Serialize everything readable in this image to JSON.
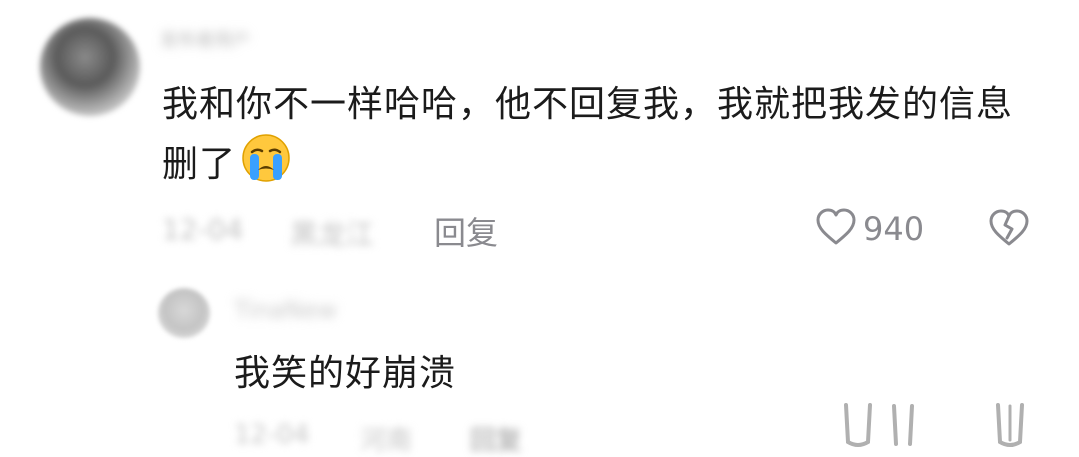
{
  "comment": {
    "username": "发布者用户",
    "text": "我和你不一样哈哈，他不回复我，我就把我发的信息删了",
    "emoji": "crying-face",
    "meta_date": "12-04",
    "meta_location": "黑龙江",
    "reply_label": "回复",
    "like_count": "940"
  },
  "reply": {
    "username": "TinaNew",
    "text": "我笑的好崩溃",
    "meta_date": "12-04",
    "meta_location": "河南",
    "reply_label": "回复"
  },
  "colors": {
    "text": "#1b1b1b",
    "muted": "#8a8a8f",
    "blurred": "#c2c2c2",
    "emoji_face": "#ffc83d",
    "emoji_tear": "#3aa0ff"
  }
}
